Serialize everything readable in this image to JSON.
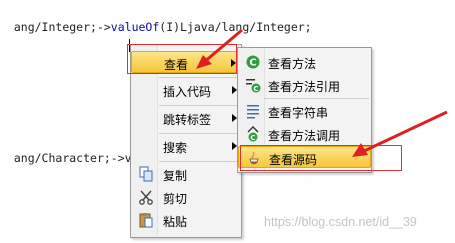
{
  "code": {
    "line1_prefix": "ang/Integer;->",
    "line1_method": "valueOf",
    "line1_suffix": "(I)Ljava/lang/Integer;",
    "line2_prefix": "ang/Character;->v"
  },
  "context_menu": {
    "items": [
      {
        "label": "查看",
        "submenu": true
      },
      {
        "label": "插入代码",
        "submenu": true
      },
      {
        "label": "跳转标签",
        "submenu": true
      },
      {
        "label": "搜索",
        "submenu": true
      },
      {
        "label": "复制"
      },
      {
        "label": "剪切"
      },
      {
        "label": "粘贴"
      }
    ]
  },
  "submenu": {
    "items": [
      {
        "label": "查看方法"
      },
      {
        "label": "查看方法引用"
      },
      {
        "label": "查看字符串"
      },
      {
        "label": "查看方法调用"
      },
      {
        "label": "查看源码"
      }
    ]
  },
  "watermark": "https://blog.csdn.net/id__39",
  "colors": {
    "highlight": "#f7c63a",
    "annotation_red": "#e03030"
  }
}
